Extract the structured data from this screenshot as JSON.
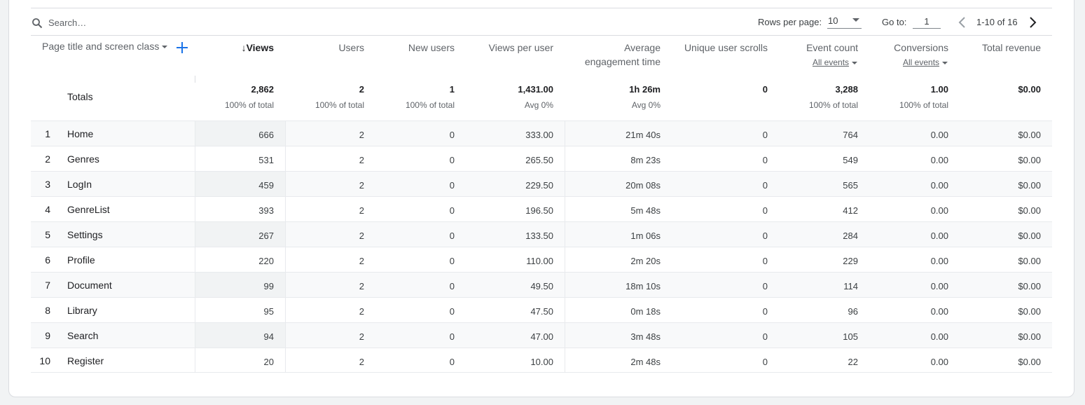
{
  "toolbar": {
    "search_placeholder": "Search…",
    "rows_per_page_label": "Rows per page:",
    "rows_per_page_value": "10",
    "goto_label": "Go to:",
    "goto_value": "1",
    "range_text": "1-10 of 16"
  },
  "columns": {
    "dimension": "Page title and screen class",
    "views": "↓Views",
    "users": "Users",
    "new_users": "New users",
    "views_per_user": "Views per user",
    "avg_engagement_line1": "Average",
    "avg_engagement_line2": "engagement time",
    "unique_scrolls": "Unique user scrolls",
    "event_count": "Event count",
    "event_count_filter": "All events",
    "conversions": "Conversions",
    "conversions_filter": "All events",
    "total_revenue": "Total revenue"
  },
  "totals": {
    "label": "Totals",
    "views": "2,862",
    "views_sub": "100% of total",
    "users": "2",
    "users_sub": "100% of total",
    "new_users": "1",
    "new_users_sub": "100% of total",
    "views_per_user": "1,431.00",
    "views_per_user_sub": "Avg 0%",
    "avg_engagement": "1h 26m",
    "avg_engagement_sub": "Avg 0%",
    "unique_scrolls": "0",
    "event_count": "3,288",
    "event_count_sub": "100% of total",
    "conversions": "1.00",
    "conversions_sub": "100% of total",
    "total_revenue": "$0.00"
  },
  "rows": [
    {
      "idx": "1",
      "name": "Home",
      "views": "666",
      "users": "2",
      "new_users": "0",
      "vpu": "333.00",
      "aet": "21m 40s",
      "scrolls": "0",
      "events": "764",
      "conv": "0.00",
      "rev": "$0.00"
    },
    {
      "idx": "2",
      "name": "Genres",
      "views": "531",
      "users": "2",
      "new_users": "0",
      "vpu": "265.50",
      "aet": "8m 23s",
      "scrolls": "0",
      "events": "549",
      "conv": "0.00",
      "rev": "$0.00"
    },
    {
      "idx": "3",
      "name": "LogIn",
      "views": "459",
      "users": "2",
      "new_users": "0",
      "vpu": "229.50",
      "aet": "20m 08s",
      "scrolls": "0",
      "events": "565",
      "conv": "0.00",
      "rev": "$0.00"
    },
    {
      "idx": "4",
      "name": "GenreList",
      "views": "393",
      "users": "2",
      "new_users": "0",
      "vpu": "196.50",
      "aet": "5m 48s",
      "scrolls": "0",
      "events": "412",
      "conv": "0.00",
      "rev": "$0.00"
    },
    {
      "idx": "5",
      "name": "Settings",
      "views": "267",
      "users": "2",
      "new_users": "0",
      "vpu": "133.50",
      "aet": "1m 06s",
      "scrolls": "0",
      "events": "284",
      "conv": "0.00",
      "rev": "$0.00"
    },
    {
      "idx": "6",
      "name": "Profile",
      "views": "220",
      "users": "2",
      "new_users": "0",
      "vpu": "110.00",
      "aet": "2m 20s",
      "scrolls": "0",
      "events": "229",
      "conv": "0.00",
      "rev": "$0.00"
    },
    {
      "idx": "7",
      "name": "Document",
      "views": "99",
      "users": "2",
      "new_users": "0",
      "vpu": "49.50",
      "aet": "18m 10s",
      "scrolls": "0",
      "events": "114",
      "conv": "0.00",
      "rev": "$0.00"
    },
    {
      "idx": "8",
      "name": "Library",
      "views": "95",
      "users": "2",
      "new_users": "0",
      "vpu": "47.50",
      "aet": "0m 18s",
      "scrolls": "0",
      "events": "96",
      "conv": "0.00",
      "rev": "$0.00"
    },
    {
      "idx": "9",
      "name": "Search",
      "views": "94",
      "users": "2",
      "new_users": "0",
      "vpu": "47.00",
      "aet": "3m 48s",
      "scrolls": "0",
      "events": "105",
      "conv": "0.00",
      "rev": "$0.00"
    },
    {
      "idx": "10",
      "name": "Register",
      "views": "20",
      "users": "2",
      "new_users": "0",
      "vpu": "10.00",
      "aet": "2m 48s",
      "scrolls": "0",
      "events": "22",
      "conv": "0.00",
      "rev": "$0.00"
    }
  ],
  "icons": {
    "search": "search-icon",
    "add": "add-icon",
    "prev": "chevron-left-icon",
    "next": "chevron-right-icon"
  },
  "colors": {
    "accent": "#1a73e8",
    "text_primary": "#202124",
    "text_secondary": "#5f6368",
    "row_alt": "#f8f9fa"
  }
}
